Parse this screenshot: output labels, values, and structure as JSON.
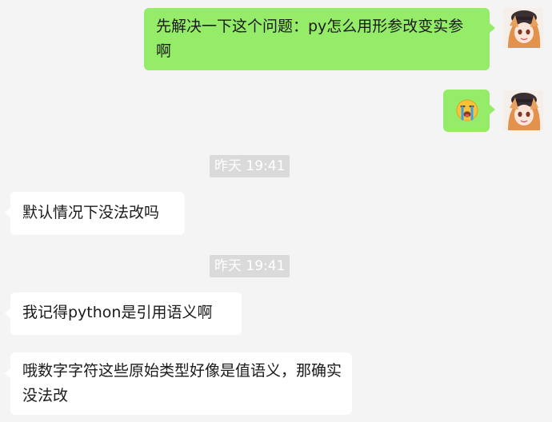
{
  "messages": [
    {
      "from": "self",
      "text": "先解决一下这个问题：py怎么用形参改变实参啊"
    },
    {
      "from": "self",
      "emoji": "crying-emoji"
    },
    {
      "from": "system",
      "text": "昨天 19:41"
    },
    {
      "from": "peer",
      "text": "默认情况下没法改吗"
    },
    {
      "from": "system",
      "text": "昨天 19:41"
    },
    {
      "from": "peer",
      "text": "我记得python是引用语义啊"
    },
    {
      "from": "peer",
      "text": "哦数字字符这些原始类型好像是值语义，那确实没法改"
    }
  ],
  "colors": {
    "self_bubble": "#95ec69",
    "peer_bubble": "#ffffff",
    "background": "#f4f4f4",
    "timestamp_bg": "#dadada"
  }
}
